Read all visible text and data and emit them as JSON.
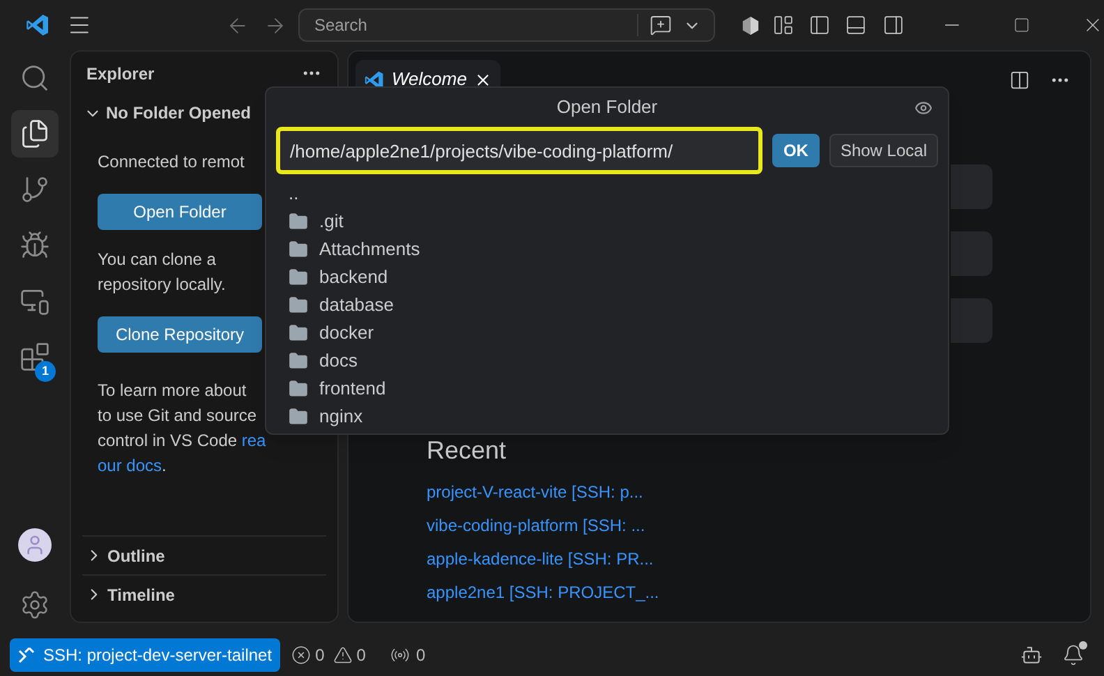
{
  "title_bar": {
    "search_placeholder": "Search"
  },
  "activity_bar": {
    "items": [
      {
        "kind": "search",
        "selected": false
      },
      {
        "kind": "explorer",
        "selected": true
      },
      {
        "kind": "source-control",
        "selected": false
      },
      {
        "kind": "run-debug",
        "selected": false
      },
      {
        "kind": "remote",
        "selected": false
      },
      {
        "kind": "extensions",
        "selected": false,
        "badge": "1"
      }
    ]
  },
  "sidebar": {
    "title": "Explorer",
    "section": {
      "title": "No Folder Opened",
      "expanded": true
    },
    "connected_text": "Connected to remot",
    "open_folder_button": "Open Folder",
    "clone_text": "You can clone a repository locally.",
    "clone_button": "Clone Repository",
    "learn_more": {
      "lines": [
        "To learn more about",
        "to use Git and source",
        "control in VS Code "
      ],
      "link_start": "rea",
      "link_end": "our docs",
      "end": "."
    },
    "panels": [
      {
        "title": "Outline",
        "expanded": false
      },
      {
        "title": "Timeline",
        "expanded": false
      }
    ]
  },
  "editor": {
    "tabs": [
      {
        "label": "Welcome",
        "selected": true
      }
    ],
    "recent": {
      "title": "Recent",
      "items": [
        "project-V-react-vite [SSH: p...",
        "vibe-coding-platform [SSH: ...",
        "apple-kadence-lite [SSH: PR...",
        "apple2ne1 [SSH: PROJECT_..."
      ]
    }
  },
  "open_folder_dialog": {
    "title": "Open Folder",
    "path": "/home/apple2ne1/projects/vibe-coding-platform/",
    "ok_button": "OK",
    "show_local_button": "Show Local",
    "entries": [
      {
        "name": "..",
        "kind": "parent"
      },
      {
        "name": ".git",
        "kind": "folder"
      },
      {
        "name": "Attachments",
        "kind": "folder"
      },
      {
        "name": "backend",
        "kind": "folder"
      },
      {
        "name": "database",
        "kind": "folder"
      },
      {
        "name": "docker",
        "kind": "folder"
      },
      {
        "name": "docs",
        "kind": "folder"
      },
      {
        "name": "frontend",
        "kind": "folder"
      },
      {
        "name": "nginx",
        "kind": "folder"
      }
    ]
  },
  "status_bar": {
    "remote": "SSH: project-dev-server-tailnet",
    "errors": "0",
    "warnings": "0",
    "ports": "0",
    "notifications_unread": true
  }
}
